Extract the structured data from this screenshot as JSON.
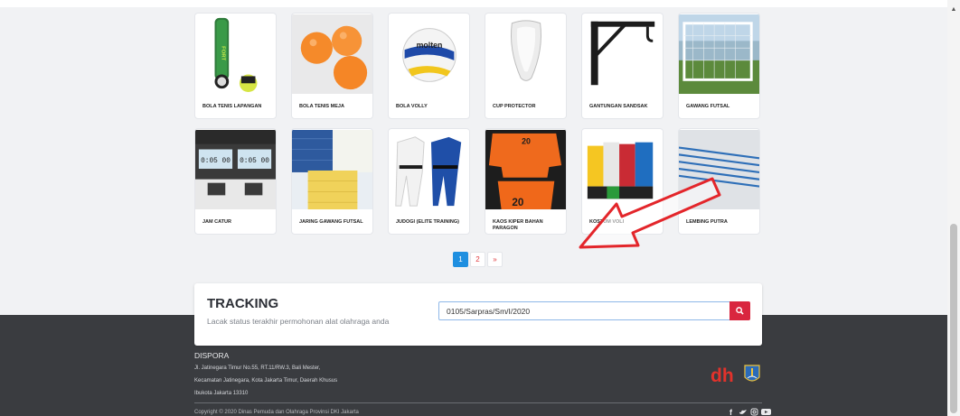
{
  "products": [
    {
      "name": "BOLA TENIS LAPANGAN",
      "icon": "tennis-ball-can-image"
    },
    {
      "name": "BOLA TENIS MEJA",
      "icon": "ping-pong-balls-image"
    },
    {
      "name": "BOLA VOLLY",
      "icon": "volleyball-image"
    },
    {
      "name": "CUP PROTECTOR",
      "icon": "cup-protector-image"
    },
    {
      "name": "GANTUNGAN SANDSAK",
      "icon": "sandbag-hanger-image"
    },
    {
      "name": "GAWANG FUTSAL",
      "icon": "futsal-goal-image"
    },
    {
      "name": "JAM CATUR",
      "icon": "chess-clock-image"
    },
    {
      "name": "JARING GAWANG FUTSAL",
      "icon": "futsal-net-image"
    },
    {
      "name": "JUDOGI (ELITE TRAINING)",
      "icon": "judogi-image"
    },
    {
      "name": "KAOS KIPER BAHAN PARAGON",
      "icon": "goalkeeper-shirt-image"
    },
    {
      "name": "KOSTUM VOLI",
      "icon": "volleyball-costume-image"
    },
    {
      "name": "LEMBING PUTRA",
      "icon": "javelin-image"
    }
  ],
  "product_image_texts": {
    "tennis_can_label": "FORT",
    "volleyball_brand": "molten",
    "chess_clock_left": "0:05 00",
    "chess_clock_right": "0:05 00",
    "jersey_number_top": "20",
    "jersey_number_bottom": "20"
  },
  "pagination": {
    "pages": [
      "1",
      "2"
    ],
    "active": "1",
    "next_label": "»"
  },
  "tracking": {
    "title": "TRACKING",
    "subtitle": "Lacak status terakhir permohonan alat olahraga anda",
    "input_value": "0105/Sarpras/Sm/I/2020",
    "search_icon": "search-icon"
  },
  "footer": {
    "org_name": "DISPORA",
    "address_line1": "Jl. Jatinegara Timur No.55, RT.11/RW.3, Bali Mester,",
    "address_line2": "Kecamatan Jatinegara, Kota Jakarta Timur, Daerah Khusus",
    "address_line3": "Ibukota Jakarta 13310",
    "copyright": "Copyright © 2020 Dinas Pemuda dan Olahraga Provinsi DKI Jakarta",
    "logo_text": "dh"
  },
  "colors": {
    "accent_red": "#d9263f",
    "accent_blue": "#1e8fe0",
    "footer_bg": "#3a3c40",
    "annotation_arrow": "#e3262b"
  }
}
